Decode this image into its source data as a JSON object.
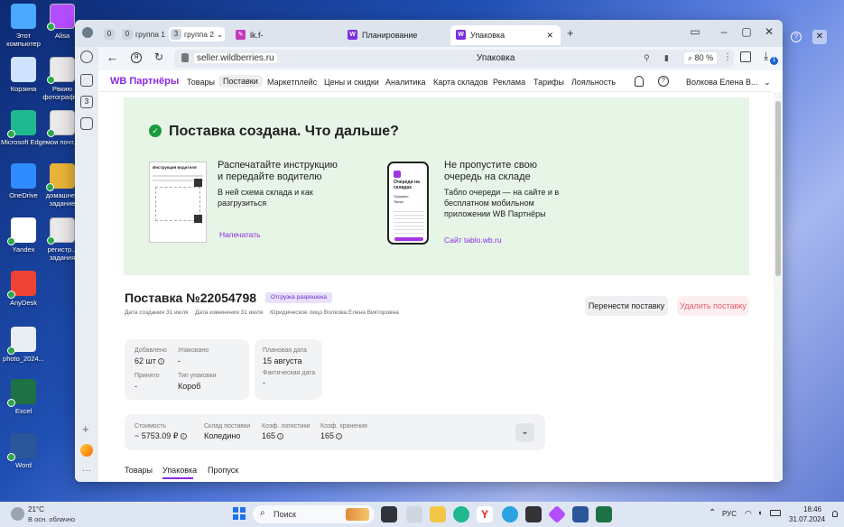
{
  "desktop": {
    "icons": [
      {
        "label": "Этот компьютер",
        "color": "#4aa8ff"
      },
      {
        "label": "Корзина",
        "color": "#cfe3ff"
      },
      {
        "label": "Microsoft Edge",
        "color": "#1fb88f"
      },
      {
        "label": "OneDrive",
        "color": "#2f8cff"
      },
      {
        "label": "Yandex",
        "color": "#ffffff"
      },
      {
        "label": "AnyDesk",
        "color": "#ef4336"
      },
      {
        "label": "photo_2024...",
        "color": "#e9eef5"
      },
      {
        "label": "Excel",
        "color": "#1e7145"
      },
      {
        "label": "Word",
        "color": "#2b579a"
      },
      {
        "label": "Alisa",
        "color": "#b44cff"
      },
      {
        "label": "Рвкию фотографий",
        "color": "#e9e9e9"
      },
      {
        "label": "мои почт...",
        "color": "#e9e9e9"
      },
      {
        "label": "домашнее задание",
        "color": "#e8b339"
      },
      {
        "label": "регистр... задания",
        "color": "#e9e9e9"
      }
    ]
  },
  "browser": {
    "tab_groups": [
      {
        "num": "0",
        "label": ""
      },
      {
        "num": "0",
        "label": "группа 1"
      },
      {
        "num": "3",
        "label": "группа 2"
      }
    ],
    "tabs": [
      {
        "label": "lk.f-skills.ru/pl/talks/conv",
        "fav": "✎"
      },
      {
        "label": "Планирование",
        "fav": "W"
      },
      {
        "label": "Упаковка",
        "fav": "W"
      }
    ],
    "address": "seller.wildberries.ru",
    "page_title": "Упаковка",
    "zoom": "80 %",
    "downloads_badge": "1",
    "rail_badge": "3"
  },
  "wb": {
    "logo": "WB Партнёры",
    "nav": [
      "Товары",
      "Поставки",
      "Маркетплейс",
      "Цены и скидки",
      "Аналитика",
      "Карта складов",
      "Реклама",
      "Тарифы",
      "Лояльность"
    ],
    "user": "Волкова Елена В...",
    "banner": {
      "title": "Поставка создана. Что дальше?",
      "left_title": "Распечатайте инструкцию\nи передайте водителю",
      "left_text": "В ней схема склада и как разгрузиться",
      "left_link": "Напечатать",
      "doc_title": "Инструкция водителя",
      "right_title": "Не пропустите свою\nочередь на складе",
      "right_text": "Табло очереди — на сайте и в бесплатном мобильном приложении WB Партнёры",
      "right_link": "Сайт tablo.wb.ru",
      "phone_title": "Очереди на складах",
      "phone_item1": "Пушкино",
      "phone_item2": "Тверь"
    },
    "supply": {
      "title": "Поставка №22054798",
      "status": "Отгрузка разрешена",
      "created": "Дата создания 31 июля",
      "changed": "Дата изменения 31 июля",
      "entity": "Юридическое лицо Волкова Елена Викторовна",
      "move_button": "Перенести поставку",
      "delete_button": "Удалить поставку"
    },
    "stats1": {
      "added_label": "Добавлено",
      "added_value": "62 шт",
      "packed_label": "Упаковано",
      "packed_value": "-",
      "accepted_label": "Принято",
      "accepted_value": "-",
      "pack_type_label": "Тип упаковки",
      "pack_type_value": "Короб"
    },
    "stats2": {
      "planned_label": "Плановая дата",
      "planned_value": "15 августа",
      "actual_label": "Фактическая дата",
      "actual_value": "-"
    },
    "stats3": {
      "cost_label": "Стоимость",
      "cost_value": "~ 5753.09 ₽",
      "warehouse_label": "Склад поставки",
      "warehouse_value": "Коледино",
      "logistics_label": "Коэф. логистики",
      "logistics_value": "165",
      "storage_label": "Коэф. хранения",
      "storage_value": "165"
    },
    "bottom_tabs": [
      "Товары",
      "Упаковка",
      "Пропуск"
    ]
  },
  "taskbar": {
    "weather_temp": "21°C",
    "weather_text": "В осн. облачно",
    "search_placeholder": "Поиск",
    "lang": "РУС",
    "time": "18:46",
    "date": "31.07.2024"
  }
}
